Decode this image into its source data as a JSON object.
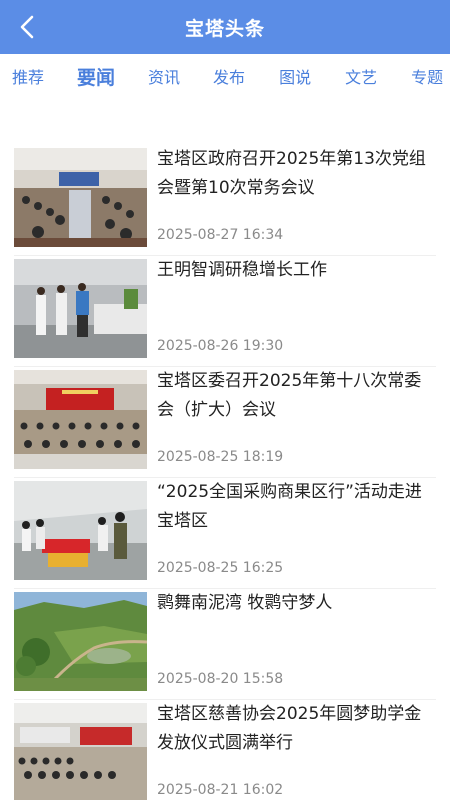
{
  "header": {
    "title": "宝塔头条",
    "back_icon": "chevron-left-icon"
  },
  "tabs": [
    {
      "label": "推荐",
      "active": false
    },
    {
      "label": "要闻",
      "active": true
    },
    {
      "label": "资讯",
      "active": false
    },
    {
      "label": "发布",
      "active": false
    },
    {
      "label": "图说",
      "active": false
    },
    {
      "label": "文艺",
      "active": false
    },
    {
      "label": "专题",
      "active": false
    }
  ],
  "news": [
    {
      "title": "宝塔区政府召开2025年第13次党组会暨第10次常务会议",
      "date": "2025-08-27 16:34",
      "thumb": "meeting-room"
    },
    {
      "title": "王明智调研稳增长工作",
      "date": "2025-08-26 19:30",
      "thumb": "factory-visit"
    },
    {
      "title": "宝塔区委召开2025年第十八次常委会（扩大）会议",
      "date": "2025-08-25 18:19",
      "thumb": "auditorium"
    },
    {
      "title": "“2025全国采购商果区行”活动走进宝塔区",
      "date": "2025-08-25 16:25",
      "thumb": "warehouse"
    },
    {
      "title": "鹮舞南泥湾 牧鹮守梦人",
      "date": "2025-08-20 15:58",
      "thumb": "landscape"
    },
    {
      "title": "宝塔区慈善协会2025年圆梦助学金发放仪式圆满举行",
      "date": "2025-08-21 16:02",
      "thumb": "ceremony"
    }
  ]
}
